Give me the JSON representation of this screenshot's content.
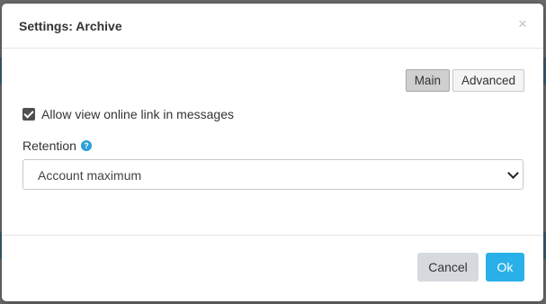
{
  "dialog": {
    "title": "Settings: Archive",
    "close_glyph": "×"
  },
  "tabs": [
    {
      "label": "Main",
      "active": true
    },
    {
      "label": "Advanced",
      "active": false
    }
  ],
  "options": {
    "allow_view_online_link": {
      "label": "Allow view online link in messages",
      "checked": true
    }
  },
  "retention": {
    "label": "Retention",
    "help_icon": "question-circle-icon",
    "selected": "Account maximum"
  },
  "footer": {
    "cancel_label": "Cancel",
    "ok_label": "Ok"
  },
  "colors": {
    "primary": "#2ab0e8",
    "help_icon": "#2a9fd8",
    "cancel_bg": "#d6d9de"
  }
}
